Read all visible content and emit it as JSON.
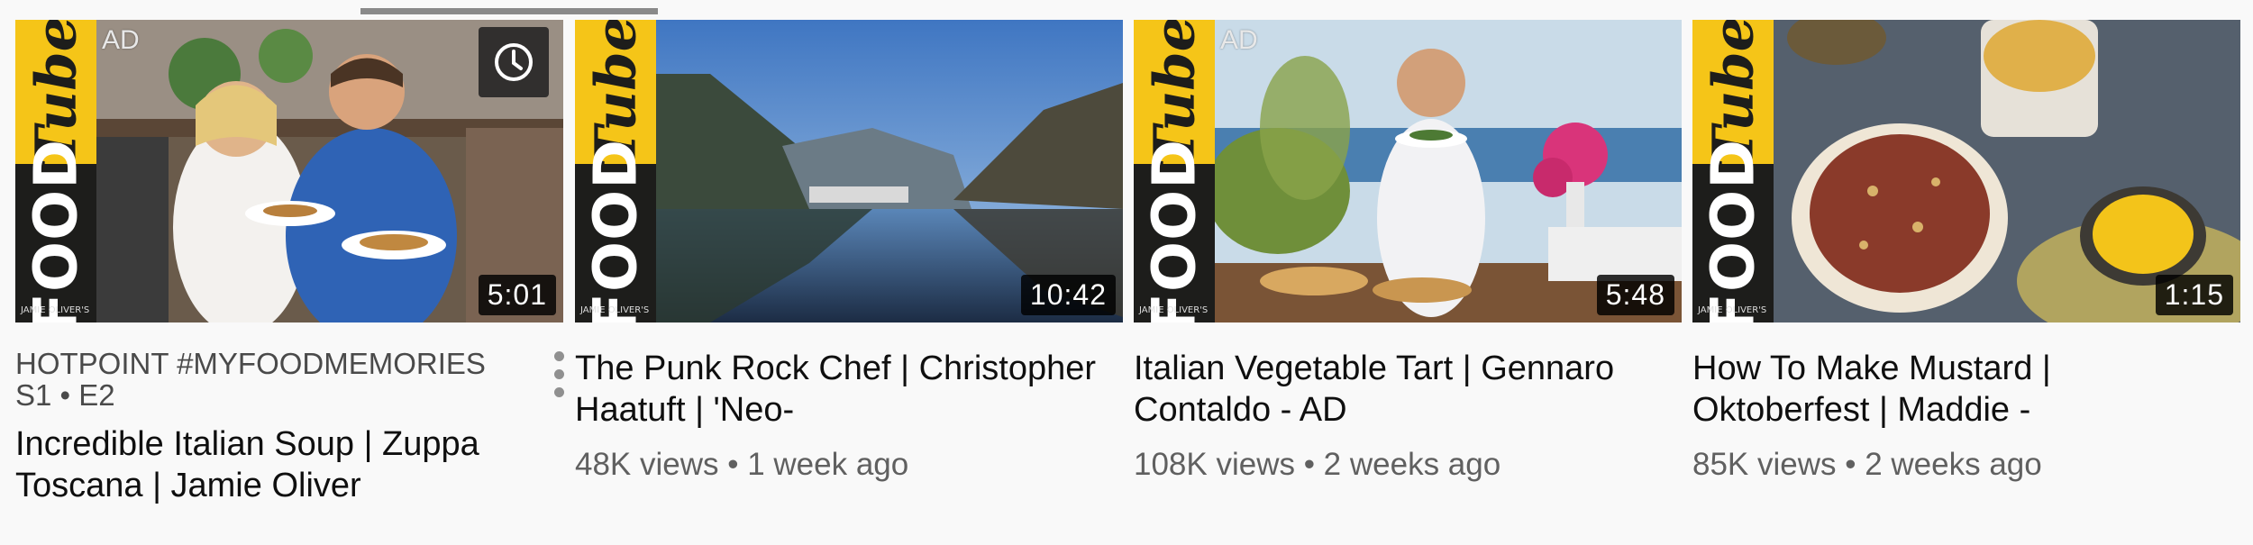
{
  "brand": {
    "tube": "Tube",
    "food": "FOOD",
    "sub": "JAMIE OLIVER'S"
  },
  "cards": [
    {
      "ad": "AD",
      "duration": "5:01",
      "playlist": "HOTPOINT #MYFOODMEMORIES  S1 • E2",
      "title": "Incredible Italian Soup | Zuppa Toscana | Jamie Oliver",
      "stats": ""
    },
    {
      "ad": "",
      "duration": "10:42",
      "playlist": "",
      "title": "The Punk Rock Chef | Christopher Haatuft | 'Neo-",
      "stats": "48K views • 1 week ago"
    },
    {
      "ad": "AD",
      "duration": "5:48",
      "playlist": "",
      "title": "Italian Vegetable Tart | Gennaro Contaldo - AD",
      "stats": "108K views • 2 weeks ago"
    },
    {
      "ad": "",
      "duration": "1:15",
      "playlist": "",
      "title": "How To Make Mustard | Oktoberfest | Maddie -",
      "stats": "85K views • 2 weeks ago"
    }
  ],
  "icons": {
    "watch_later": "clock-icon",
    "more": "more-vert-icon"
  },
  "colors": {
    "brand_yellow": "#f5c518",
    "brand_dark": "#1d1d1b",
    "meta_grey": "#606060"
  }
}
